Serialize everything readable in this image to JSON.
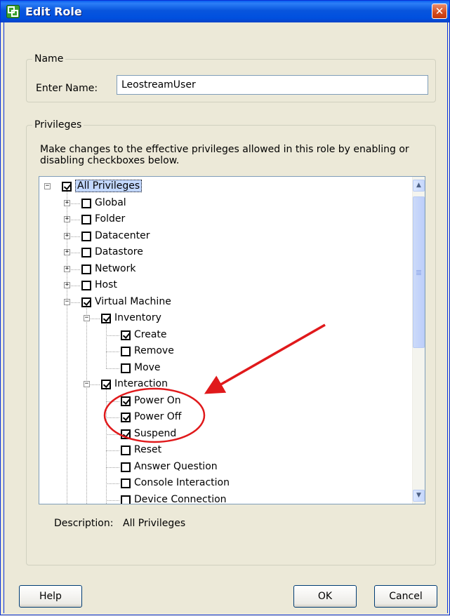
{
  "window": {
    "title": "Edit Role",
    "close_glyph": "✕"
  },
  "name_group": {
    "legend": "Name",
    "label": "Enter Name:",
    "value": "LeostreamUser"
  },
  "privileges_group": {
    "legend": "Privileges",
    "instructions": "Make changes to the effective privileges allowed in this role by enabling or disabling checkboxes below."
  },
  "tree": {
    "nodes": [
      {
        "label": "All Privileges",
        "checked": true,
        "level": 0,
        "expander": "minus",
        "selected": true
      },
      {
        "label": "Global",
        "checked": false,
        "level": 1,
        "expander": "plus"
      },
      {
        "label": "Folder",
        "checked": false,
        "level": 1,
        "expander": "plus"
      },
      {
        "label": "Datacenter",
        "checked": false,
        "level": 1,
        "expander": "plus"
      },
      {
        "label": "Datastore",
        "checked": false,
        "level": 1,
        "expander": "plus"
      },
      {
        "label": "Network",
        "checked": false,
        "level": 1,
        "expander": "plus"
      },
      {
        "label": "Host",
        "checked": false,
        "level": 1,
        "expander": "plus"
      },
      {
        "label": "Virtual Machine",
        "checked": true,
        "level": 1,
        "expander": "minus"
      },
      {
        "label": "Inventory",
        "checked": true,
        "level": 2,
        "expander": "minus"
      },
      {
        "label": "Create",
        "checked": true,
        "level": 3
      },
      {
        "label": "Remove",
        "checked": false,
        "level": 3
      },
      {
        "label": "Move",
        "checked": false,
        "level": 3
      },
      {
        "label": "Interaction",
        "checked": true,
        "level": 2,
        "expander": "minus"
      },
      {
        "label": "Power On",
        "checked": true,
        "level": 3
      },
      {
        "label": "Power Off",
        "checked": true,
        "level": 3
      },
      {
        "label": "Suspend",
        "checked": true,
        "level": 3
      },
      {
        "label": "Reset",
        "checked": false,
        "level": 3
      },
      {
        "label": "Answer Question",
        "checked": false,
        "level": 3
      },
      {
        "label": "Console Interaction",
        "checked": false,
        "level": 3
      },
      {
        "label": "Device Connection",
        "checked": false,
        "level": 3
      }
    ]
  },
  "description": {
    "label": "Description:",
    "value": "All Privileges"
  },
  "buttons": {
    "help": "Help",
    "ok": "OK",
    "cancel": "Cancel"
  },
  "annotation": {
    "color": "#e0191b"
  }
}
